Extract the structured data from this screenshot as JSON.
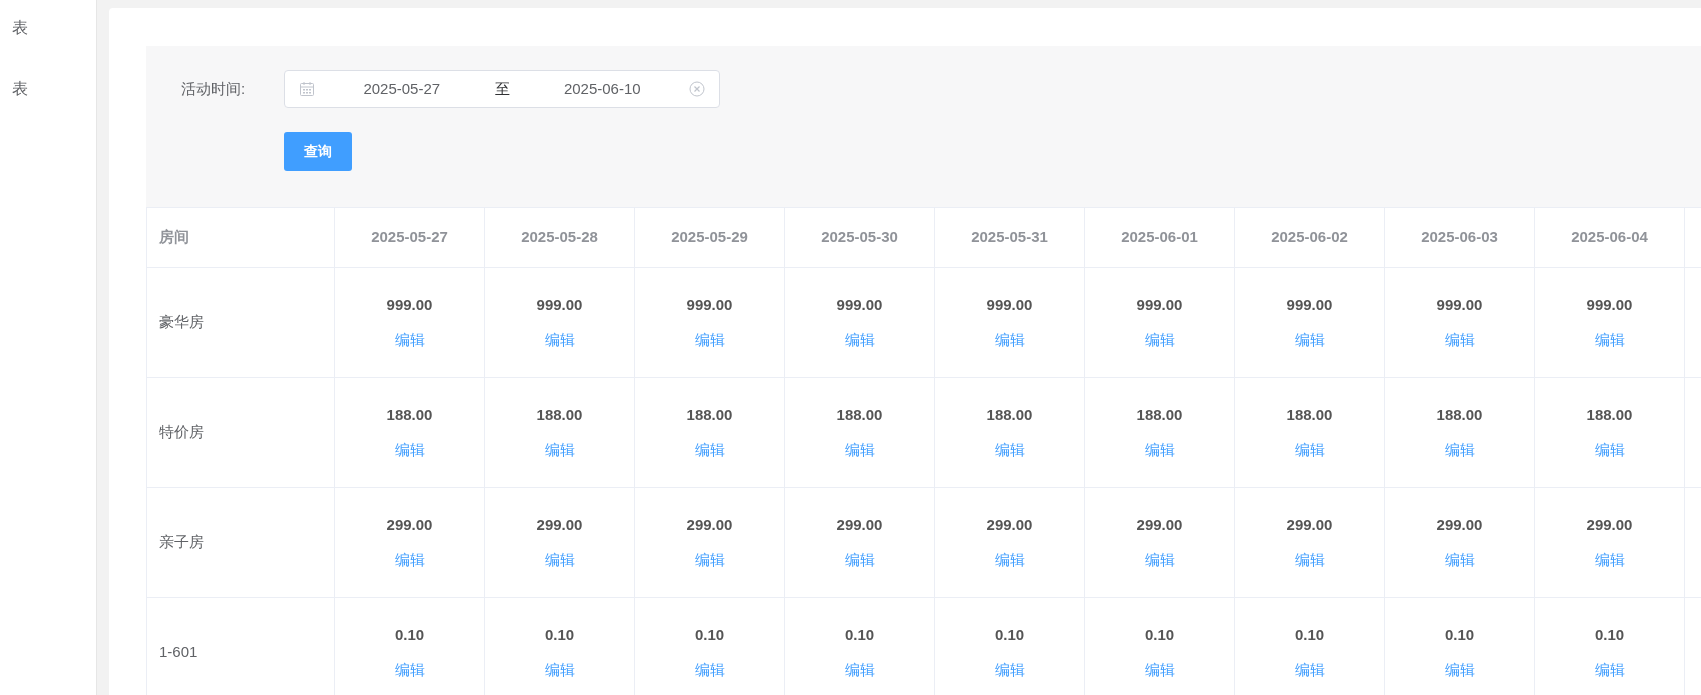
{
  "sidebar": {
    "items": [
      {
        "label": "表"
      },
      {
        "label": "表"
      }
    ]
  },
  "filter": {
    "label": "活动时间:",
    "start": "2025-05-27",
    "separator": "至",
    "end": "2025-06-10",
    "button": "查询"
  },
  "table": {
    "columns": [
      "房间",
      "2025-05-27",
      "2025-05-28",
      "2025-05-29",
      "2025-05-30",
      "2025-05-31",
      "2025-06-01",
      "2025-06-02",
      "2025-06-03",
      "2025-06-04"
    ],
    "rows": [
      {
        "cells": [
          {
            "kind": "room",
            "text": "豪华房"
          },
          {
            "kind": "price",
            "price": "999.00",
            "action": "编辑"
          },
          {
            "kind": "price",
            "price": "999.00",
            "action": "编辑"
          },
          {
            "kind": "price",
            "price": "999.00",
            "action": "编辑"
          },
          {
            "kind": "price",
            "price": "999.00",
            "action": "编辑"
          },
          {
            "kind": "price",
            "price": "999.00",
            "action": "编辑"
          },
          {
            "kind": "price",
            "price": "999.00",
            "action": "编辑"
          },
          {
            "kind": "price",
            "price": "999.00",
            "action": "编辑"
          },
          {
            "kind": "price",
            "price": "999.00",
            "action": "编辑"
          },
          {
            "kind": "price",
            "price": "999.00",
            "action": "编辑"
          }
        ]
      },
      {
        "cells": [
          {
            "kind": "room",
            "text": "特价房"
          },
          {
            "kind": "price",
            "price": "188.00",
            "action": "编辑"
          },
          {
            "kind": "price",
            "price": "188.00",
            "action": "编辑"
          },
          {
            "kind": "price",
            "price": "188.00",
            "action": "编辑"
          },
          {
            "kind": "price",
            "price": "188.00",
            "action": "编辑"
          },
          {
            "kind": "price",
            "price": "188.00",
            "action": "编辑"
          },
          {
            "kind": "price",
            "price": "188.00",
            "action": "编辑"
          },
          {
            "kind": "price",
            "price": "188.00",
            "action": "编辑"
          },
          {
            "kind": "price",
            "price": "188.00",
            "action": "编辑"
          },
          {
            "kind": "price",
            "price": "188.00",
            "action": "编辑"
          }
        ]
      },
      {
        "cells": [
          {
            "kind": "room",
            "text": "亲子房"
          },
          {
            "kind": "price",
            "price": "299.00",
            "action": "编辑"
          },
          {
            "kind": "price",
            "price": "299.00",
            "action": "编辑"
          },
          {
            "kind": "price",
            "price": "299.00",
            "action": "编辑"
          },
          {
            "kind": "price",
            "price": "299.00",
            "action": "编辑"
          },
          {
            "kind": "price",
            "price": "299.00",
            "action": "编辑"
          },
          {
            "kind": "price",
            "price": "299.00",
            "action": "编辑"
          },
          {
            "kind": "price",
            "price": "299.00",
            "action": "编辑"
          },
          {
            "kind": "price",
            "price": "299.00",
            "action": "编辑"
          },
          {
            "kind": "price",
            "price": "299.00",
            "action": "编辑"
          }
        ]
      },
      {
        "cells": [
          {
            "kind": "room",
            "text": "1-601"
          },
          {
            "kind": "price",
            "price": "0.10",
            "action": "编辑"
          },
          {
            "kind": "price",
            "price": "0.10",
            "action": "编辑"
          },
          {
            "kind": "price",
            "price": "0.10",
            "action": "编辑"
          },
          {
            "kind": "price",
            "price": "0.10",
            "action": "编辑"
          },
          {
            "kind": "price",
            "price": "0.10",
            "action": "编辑"
          },
          {
            "kind": "price",
            "price": "0.10",
            "action": "编辑"
          },
          {
            "kind": "price",
            "price": "0.10",
            "action": "编辑"
          },
          {
            "kind": "price",
            "price": "0.10",
            "action": "编辑"
          },
          {
            "kind": "price",
            "price": "0.10",
            "action": "编辑"
          }
        ]
      }
    ]
  }
}
